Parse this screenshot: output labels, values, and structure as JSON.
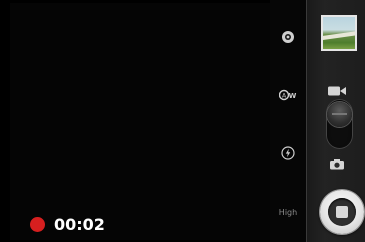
{
  "recording": {
    "time": "00:02",
    "indicator_color": "#d61f1f"
  },
  "settings": {
    "items": [
      {
        "name": "camera-settings",
        "icon": "settings-knob-icon"
      },
      {
        "name": "white-balance",
        "icon": "white-balance-auto-icon",
        "label": "AW"
      },
      {
        "name": "flash",
        "icon": "flash-auto-icon"
      },
      {
        "name": "video-quality",
        "label": "High"
      }
    ]
  },
  "controls": {
    "mode": "video",
    "video_icon": "video-camera-icon",
    "photo_icon": "camera-icon",
    "shutter_state": "stop"
  }
}
